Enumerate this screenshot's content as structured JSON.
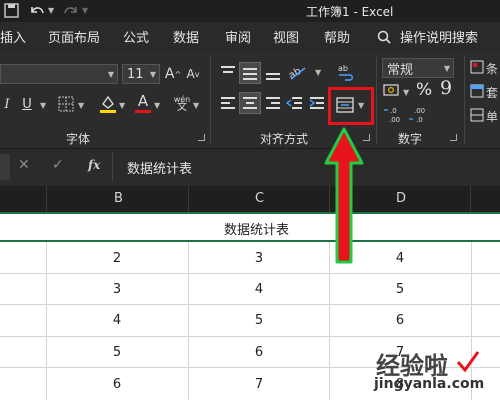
{
  "window": {
    "title": "工作簿1 - Excel"
  },
  "menu": [
    "插入",
    "页面布局",
    "公式",
    "数据",
    "审阅",
    "视图",
    "帮助",
    "操作说明搜索"
  ],
  "ribbon": {
    "font_size": "11",
    "grow_font": "A",
    "shrink_font": "A",
    "italic": "I",
    "underline": "U",
    "font_color_letter": "A",
    "wen": "wén",
    "number_format": "常规",
    "percent": "%",
    "comma": "9",
    "groups": {
      "font": "字体",
      "alignment": "对齐方式",
      "number": "数字"
    },
    "cut_labels": [
      "条",
      "套",
      "单"
    ]
  },
  "formula_bar": {
    "fx": "fx",
    "content": "数据统计表"
  },
  "columns": [
    "B",
    "C",
    "D"
  ],
  "sheet": {
    "merged_title": "数据统计表",
    "rows": [
      [
        "2",
        "3",
        "4"
      ],
      [
        "3",
        "4",
        "5"
      ],
      [
        "4",
        "5",
        "6"
      ],
      [
        "5",
        "6",
        "7"
      ],
      [
        "6",
        "7",
        "8"
      ]
    ]
  },
  "watermark": {
    "text": "经验啦",
    "url": "jingyanla.com"
  },
  "colors": {
    "annotation_red": "#e8141c",
    "arrow_green": "#22cc44",
    "grid_green": "#1e7145"
  }
}
